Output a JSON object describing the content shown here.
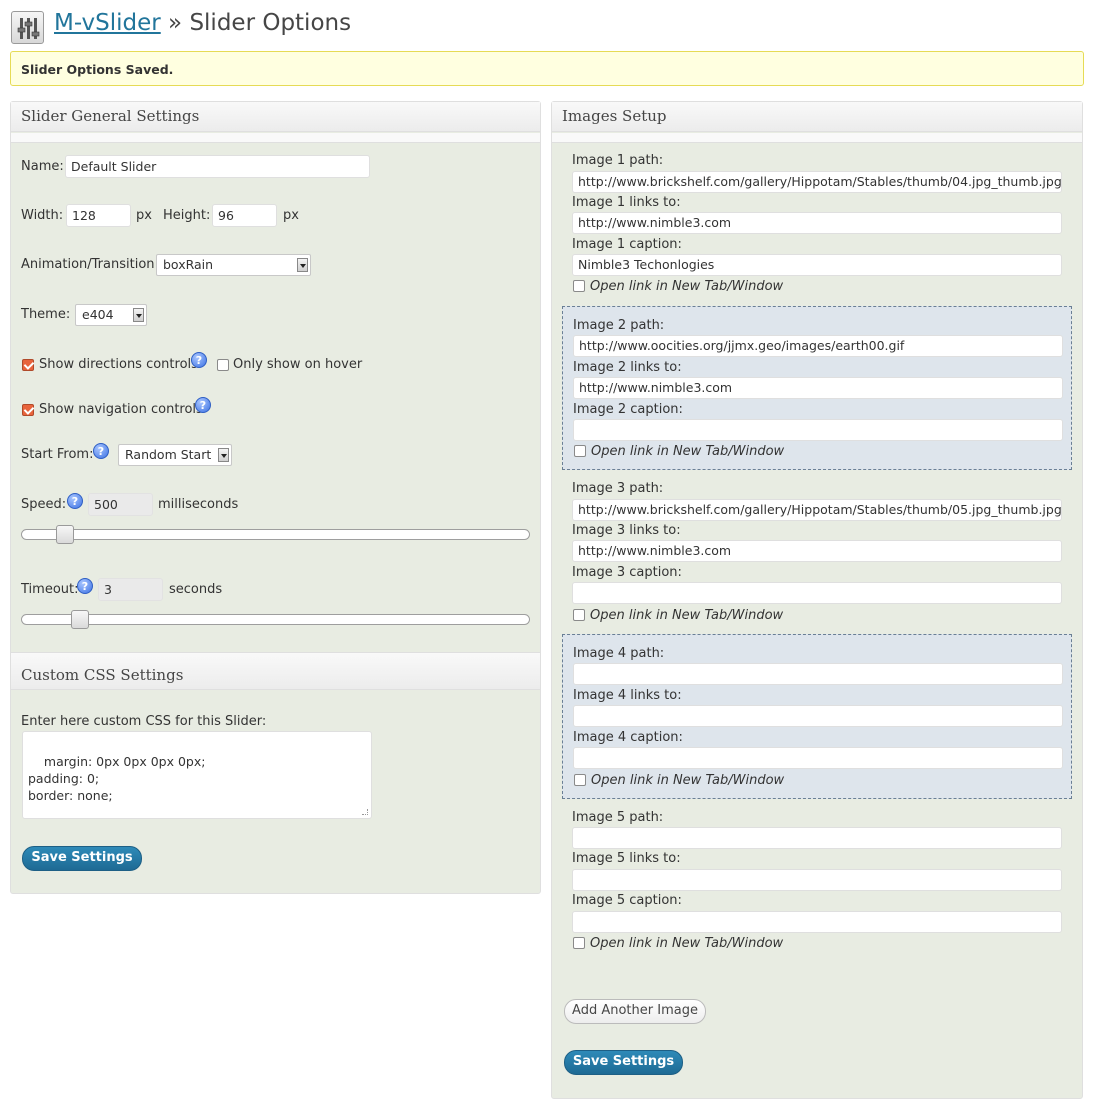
{
  "header": {
    "plugin_link": "M-vSlider",
    "separator": " » ",
    "title": "Slider Options"
  },
  "notice": "Slider Options Saved.",
  "general": {
    "heading": "Slider General Settings",
    "name_label": "Name:",
    "name_value": "Default Slider",
    "width_label": "Width:",
    "width_value": "128",
    "px1": "px",
    "height_label": "Height:",
    "height_value": "96",
    "px2": "px",
    "animation_label": "Animation/Transition:",
    "animation_value": "boxRain",
    "theme_label": "Theme:",
    "theme_value": "e404",
    "show_directions_label": "Show directions controls",
    "show_directions_checked": true,
    "only_hover_label": "Only show on hover",
    "only_hover_checked": false,
    "show_navigation_label": "Show navigation controls",
    "show_navigation_checked": true,
    "start_from_label": "Start From:",
    "start_from_value": "Random Start",
    "speed_label": "Speed:",
    "speed_value": "500",
    "speed_unit": "milliseconds",
    "speed_slider_fraction": 0.07,
    "timeout_label": "Timeout:",
    "timeout_value": "3",
    "timeout_unit": "seconds",
    "timeout_slider_fraction": 0.1,
    "help_glyph": "?"
  },
  "css": {
    "heading": "Custom CSS Settings",
    "label": "Enter here custom CSS for this Slider:",
    "value": "margin: 0px 0px 0px 0px;\npadding: 0;\nborder: none;",
    "save_label": "Save Settings"
  },
  "images": {
    "heading": "Images Setup",
    "items": [
      {
        "path_label": "Image 1 path:",
        "path_value": "http://www.brickshelf.com/gallery/Hippotam/Stables/thumb/04.jpg_thumb.jpg",
        "links_label": "Image 1 links to:",
        "links_value": "http://www.nimble3.com",
        "caption_label": "Image 1 caption:",
        "caption_value": "Nimble3 Techonlogies",
        "newtab_label": "Open link in New Tab/Window",
        "newtab_checked": false
      },
      {
        "path_label": "Image 2 path:",
        "path_value": "http://www.oocities.org/jjmx.geo/images/earth00.gif",
        "links_label": "Image 2 links to:",
        "links_value": "http://www.nimble3.com",
        "caption_label": "Image 2 caption:",
        "caption_value": "",
        "newtab_label": "Open link in New Tab/Window",
        "newtab_checked": false
      },
      {
        "path_label": "Image 3 path:",
        "path_value": "http://www.brickshelf.com/gallery/Hippotam/Stables/thumb/05.jpg_thumb.jpg",
        "links_label": "Image 3 links to:",
        "links_value": "http://www.nimble3.com",
        "caption_label": "Image 3 caption:",
        "caption_value": "",
        "newtab_label": "Open link in New Tab/Window",
        "newtab_checked": false
      },
      {
        "path_label": "Image 4 path:",
        "path_value": "",
        "links_label": "Image 4 links to:",
        "links_value": "",
        "caption_label": "Image 4 caption:",
        "caption_value": "",
        "newtab_label": "Open link in New Tab/Window",
        "newtab_checked": false
      },
      {
        "path_label": "Image 5 path:",
        "path_value": "",
        "links_label": "Image 5 links to:",
        "links_value": "",
        "caption_label": "Image 5 caption:",
        "caption_value": "",
        "newtab_label": "Open link in New Tab/Window",
        "newtab_checked": false
      }
    ],
    "add_label": "Add Another Image",
    "save_label": "Save Settings"
  },
  "colors": {
    "link": "#21759b",
    "notice_bg": "#ffffe0",
    "panel_bg": "#e8ece2",
    "alt_block_bg": "#dee5ec",
    "primary_button": "#21759b",
    "checkbox_checked": "#e8643c"
  },
  "icons": {
    "header": "settings-sliders-icon",
    "help": "help-icon"
  }
}
